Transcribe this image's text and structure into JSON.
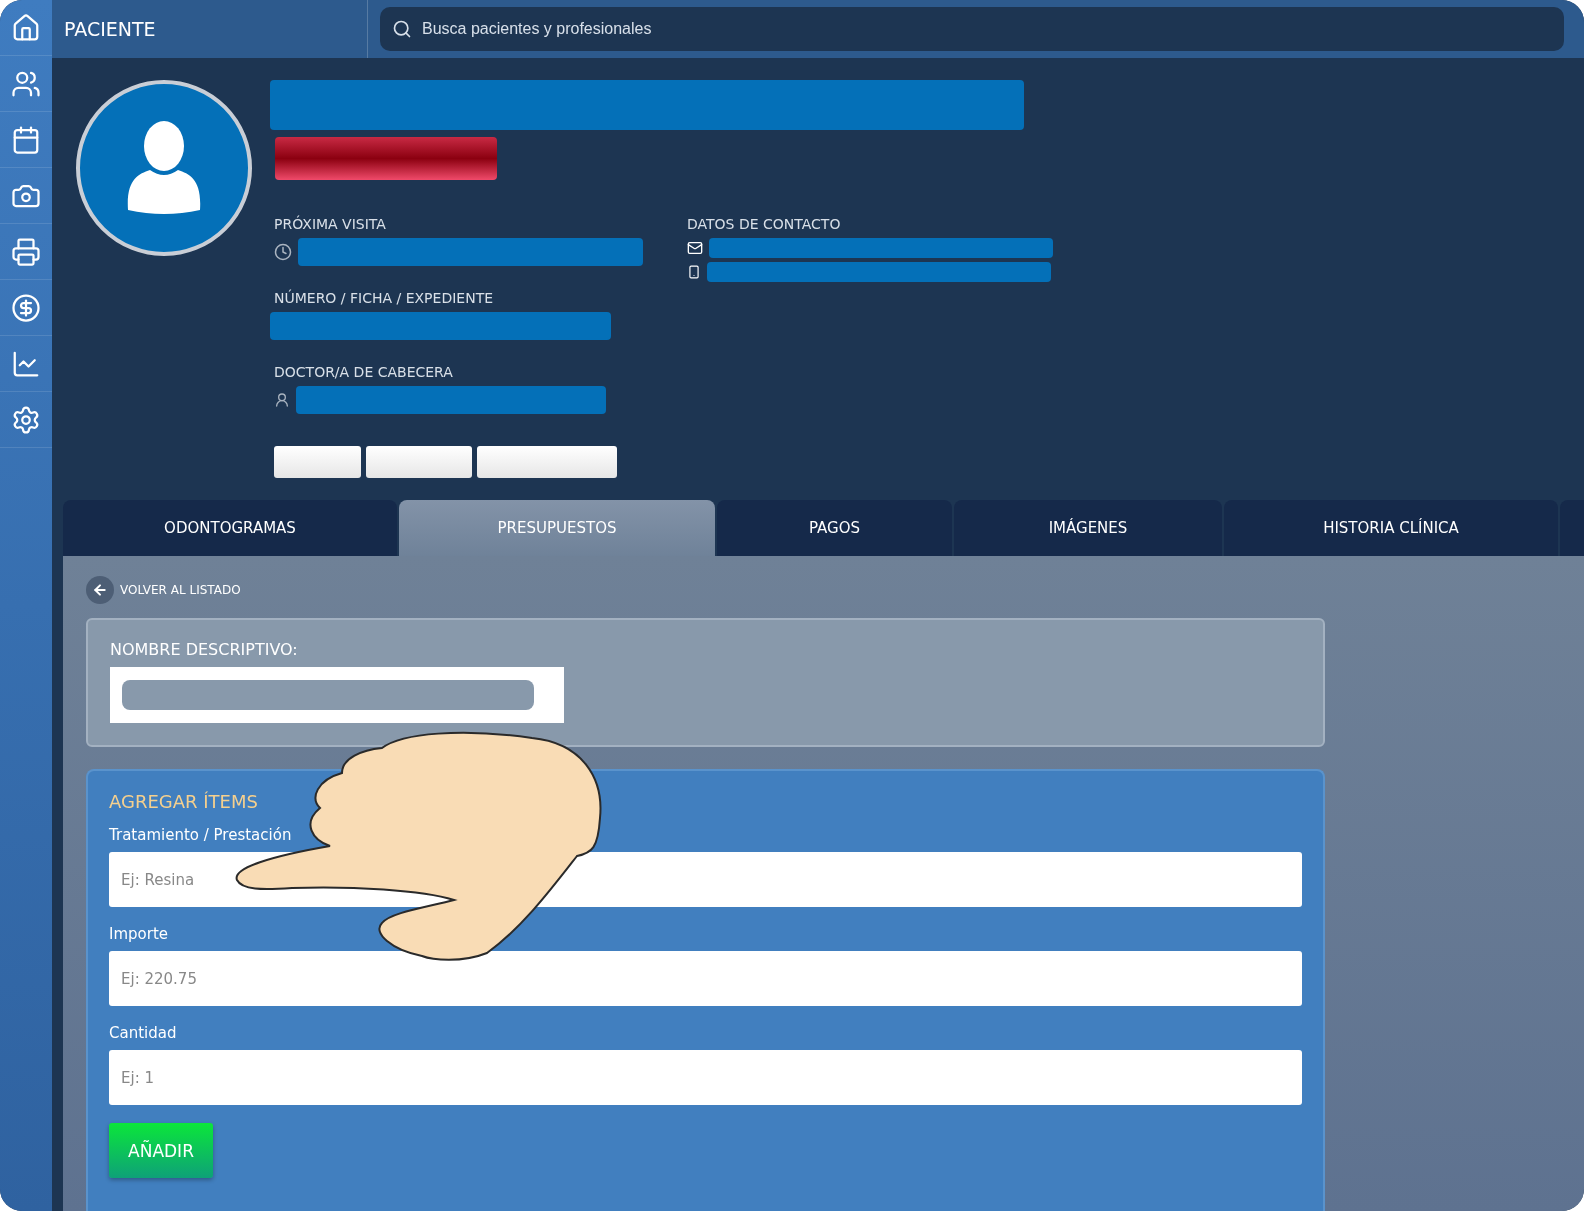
{
  "header": {
    "title": "PACIENTE",
    "search": {
      "placeholder": "Busca pacientes y profesionales"
    }
  },
  "profile": {
    "fields": [
      {
        "label": "PRÓXIMA VISITA"
      },
      {
        "label": "NÚMERO / FICHA / EXPEDIENTE"
      },
      {
        "label": "DOCTOR/A DE CABECERA"
      }
    ],
    "contact": {
      "label": "DATOS DE CONTACTO"
    }
  },
  "tabs": [
    {
      "label": "ODONTOGRAMAS",
      "selected": false
    },
    {
      "label": "PRESUPUESTOS",
      "selected": true
    },
    {
      "label": "PAGOS",
      "selected": false
    },
    {
      "label": "IMÁGENES",
      "selected": false
    },
    {
      "label": "HISTORIA CLÍNICA",
      "selected": false
    }
  ],
  "back_link": "VOLVER AL LISTADO",
  "name_card": {
    "label": "NOMBRE DESCRIPTIVO:"
  },
  "items_form": {
    "title": "AGREGAR ÍTEMS",
    "fields": [
      {
        "label": "Tratamiento / Prestación",
        "placeholder": "Ej: Resina"
      },
      {
        "label": "Importe",
        "placeholder": "Ej: 220.75"
      },
      {
        "label": "Cantidad",
        "placeholder": "Ej: 1"
      }
    ],
    "button": "AÑADIR"
  }
}
